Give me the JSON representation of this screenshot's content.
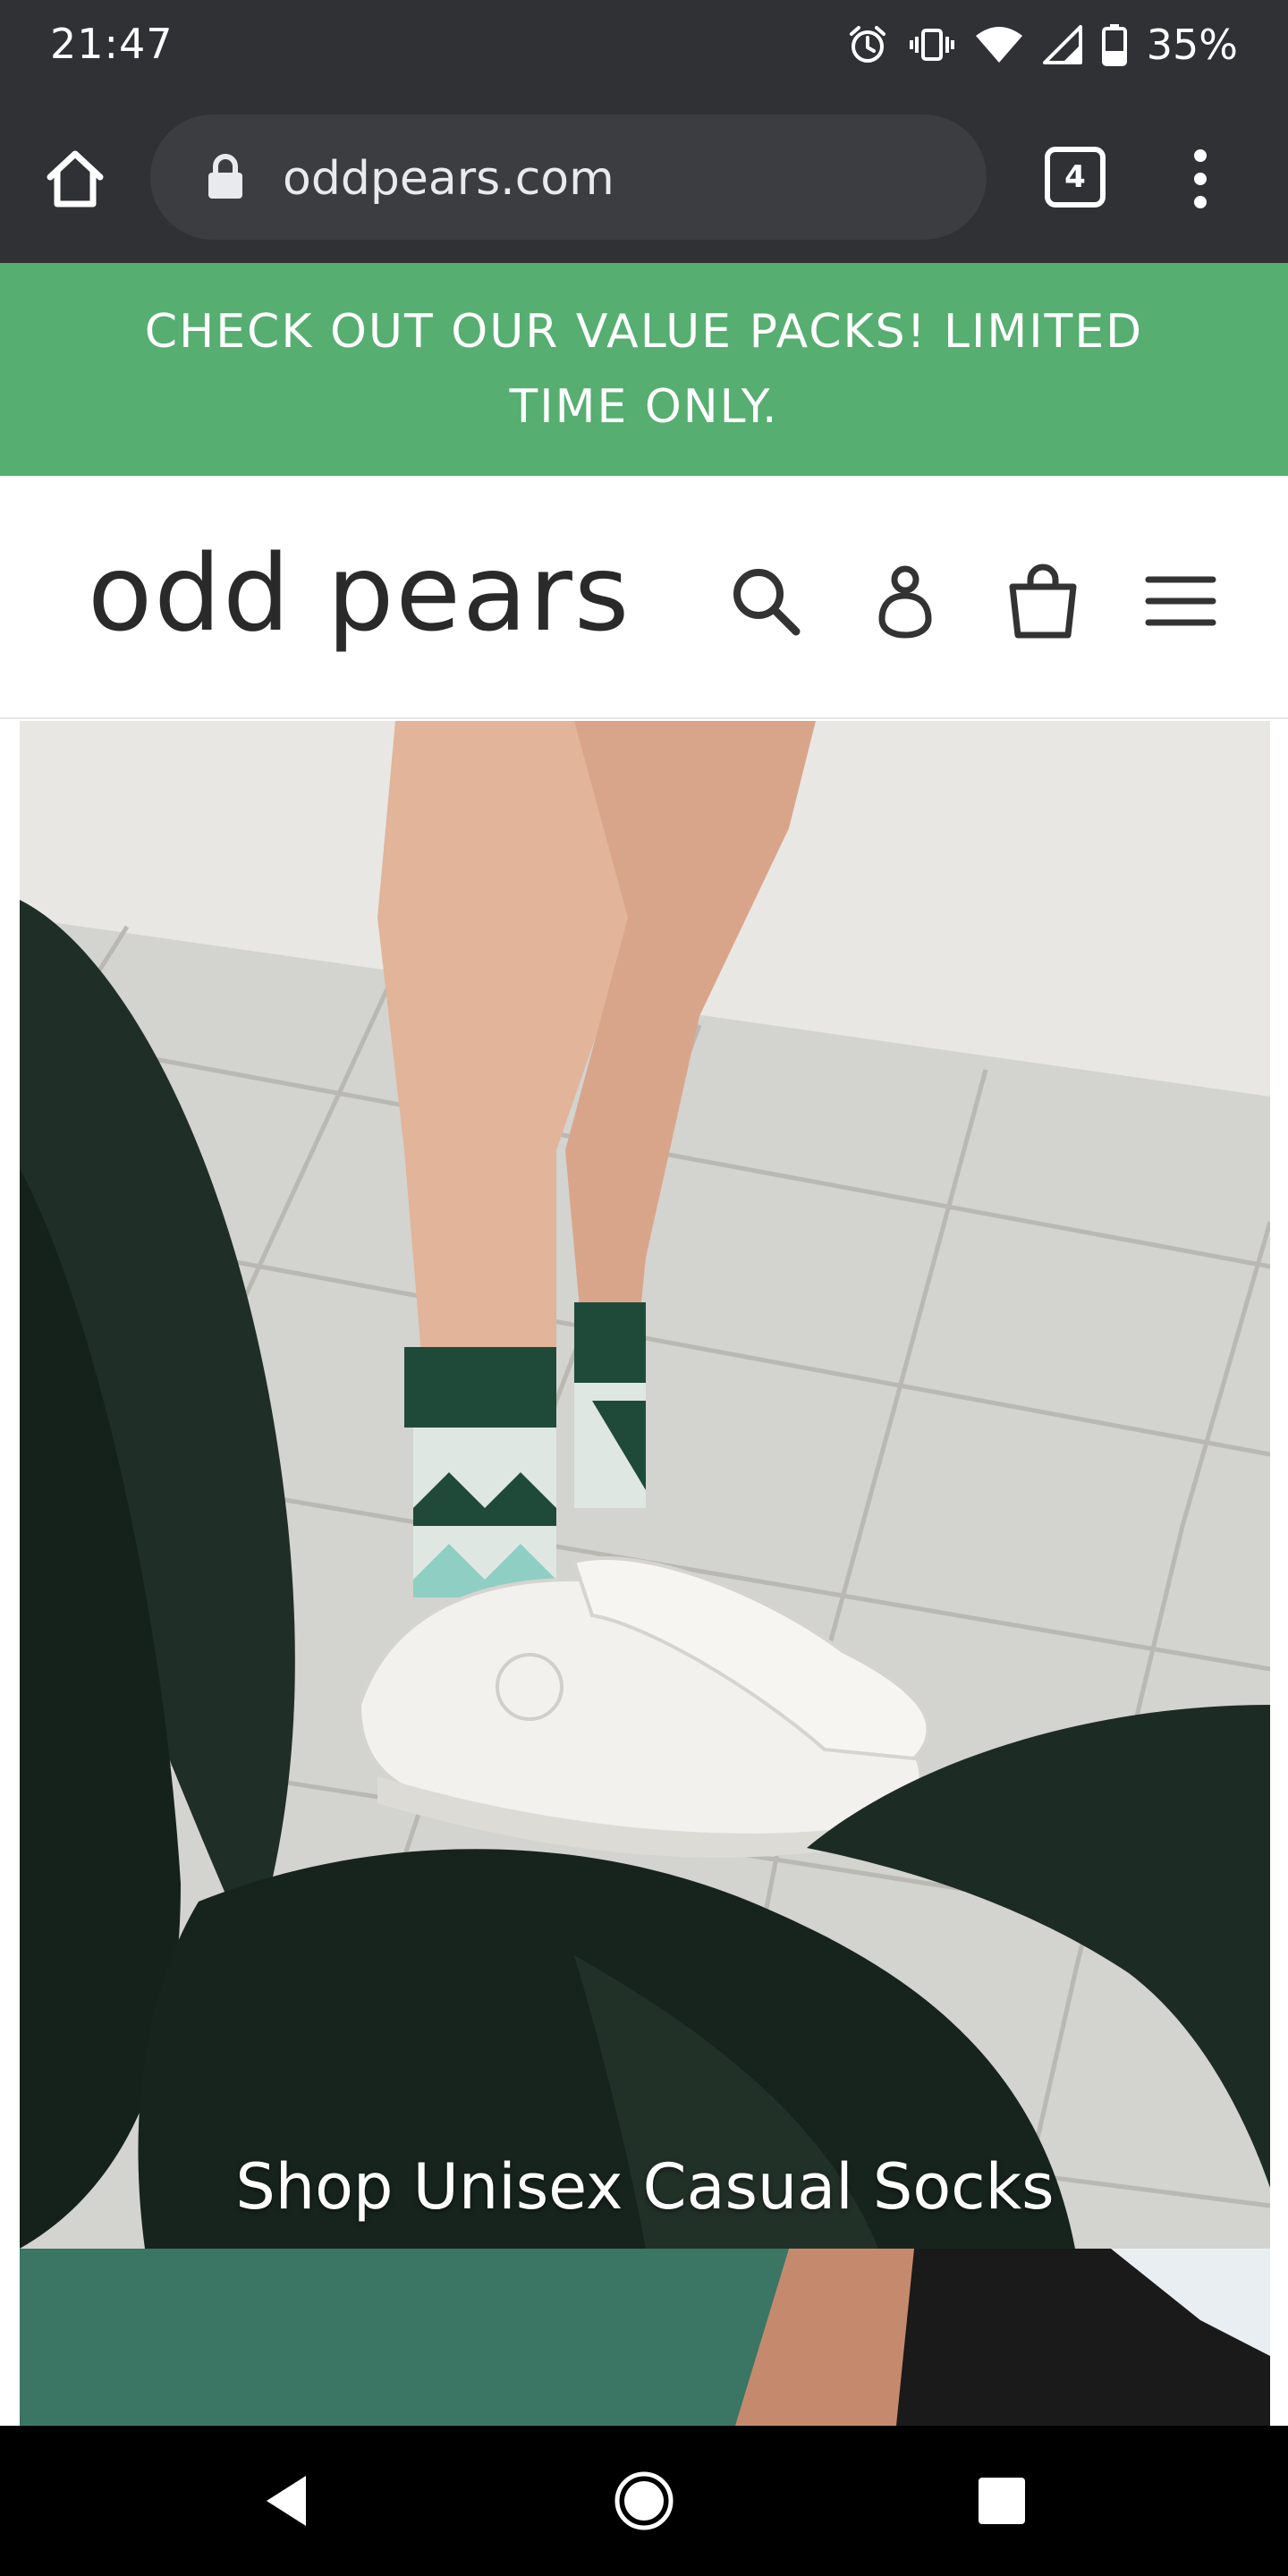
{
  "status_bar": {
    "time": "21:47",
    "battery_percent": "35%",
    "icons": [
      "alarm-icon",
      "vibrate-icon",
      "wifi-icon",
      "signal-icon",
      "battery-icon"
    ]
  },
  "browser": {
    "url": "oddpears.com",
    "tab_count": "4",
    "icons": [
      "home-icon",
      "lock-icon",
      "tabs-icon",
      "more-vert-icon"
    ]
  },
  "announcement": {
    "text": "CHECK OUT OUR VALUE PACKS! LIMITED TIME ONLY.",
    "background_color": "#56ae71"
  },
  "site_header": {
    "logo_text": "odd pears",
    "icons": [
      "search-icon",
      "account-icon",
      "cart-icon",
      "hamburger-menu-icon"
    ]
  },
  "hero": {
    "caption": "Shop Unisex Casual Socks"
  },
  "nav_bar": {
    "icons": [
      "back-icon",
      "home-circle-icon",
      "recents-icon"
    ]
  }
}
